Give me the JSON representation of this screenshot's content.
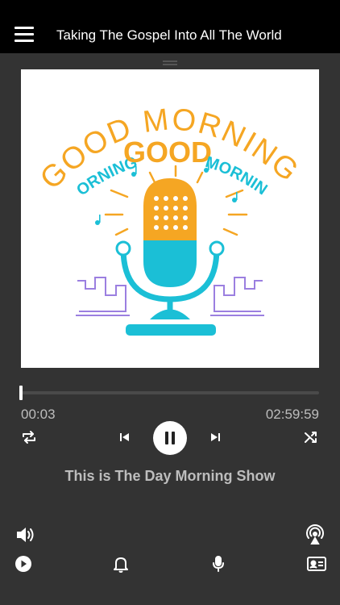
{
  "header": {
    "title": "Taking The Gospel Into All The World"
  },
  "artwork": {
    "line1": "GOOD MORNING!",
    "line2_left": "MORNING",
    "line2_center": "GOOD",
    "line2_right": "MORNING!"
  },
  "player": {
    "current_time": "00:03",
    "total_time": "02:59:59",
    "progress": 0.0003,
    "state": "playing",
    "show_title": "This is The Day Morning Show"
  },
  "colors": {
    "accent_orange": "#f5a623",
    "accent_teal": "#1bbfd6",
    "accent_purple": "#9b7fe0"
  }
}
